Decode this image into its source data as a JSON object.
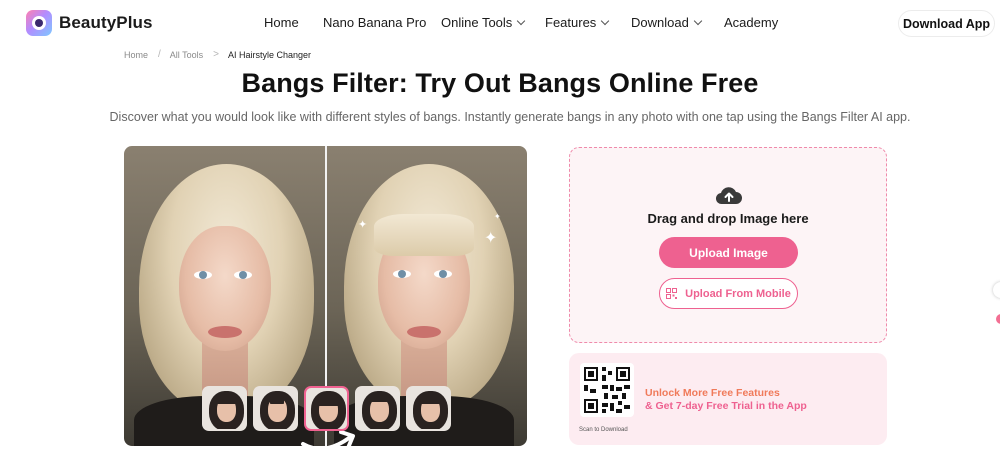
{
  "header": {
    "brand": "BeautyPlus",
    "nav": [
      {
        "label": "Home",
        "dropdown": false
      },
      {
        "label": "Nano Banana Pro",
        "dropdown": false
      },
      {
        "label": "Online Tools",
        "dropdown": true
      },
      {
        "label": "Features",
        "dropdown": true
      },
      {
        "label": "Download",
        "dropdown": true
      },
      {
        "label": "Academy",
        "dropdown": false
      }
    ],
    "cta": "Download App"
  },
  "breadcrumb": [
    "Home",
    "All Tools",
    "AI Hairstyle Changer"
  ],
  "page": {
    "title": "Bangs Filter: Try Out Bangs Online Free",
    "subtitle": "Discover what you would look like with different styles of bangs. Instantly generate bangs in any photo with one tap using the Bangs Filter AI app."
  },
  "uploader": {
    "drag_text": "Drag and drop Image here",
    "upload_button": "Upload Image",
    "mobile_button": "Upload From Mobile"
  },
  "promo": {
    "line1": "Unlock More Free Features",
    "line2": "& Get 7-day Free Trial in the App",
    "scan_label": "Scan to Download"
  },
  "colors": {
    "accent": "#ee6190",
    "upload_bg": "#fdf4f6",
    "promo_bg": "#fdecf1"
  },
  "icons": [
    "cloud-upload-icon",
    "qr-code-icon",
    "chevron-down-icon",
    "sparkle-icon",
    "curved-arrow-icon"
  ]
}
